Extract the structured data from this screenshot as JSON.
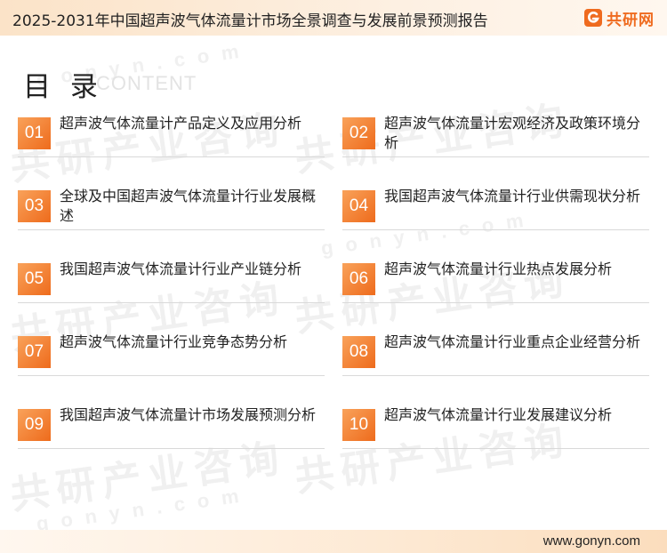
{
  "header": {
    "title": "2025-2031年中国超声波气体流量计市场全景调查与发展前景预测报告",
    "brand": "共研网",
    "logo_icon": "g-logo-icon"
  },
  "toc": {
    "heading": "目 录",
    "subheading": "CONTENT"
  },
  "watermark": {
    "cn": "共研产业咨询",
    "en": "gonyn.com"
  },
  "items": [
    {
      "num": "01",
      "label": "超声波气体流量计产品定义及应用分析"
    },
    {
      "num": "02",
      "label": "超声波气体流量计宏观经济及政策环境分析"
    },
    {
      "num": "03",
      "label": "全球及中国超声波气体流量计行业发展概述"
    },
    {
      "num": "04",
      "label": "我国超声波气体流量计行业供需现状分析"
    },
    {
      "num": "05",
      "label": "我国超声波气体流量计行业产业链分析"
    },
    {
      "num": "06",
      "label": "超声波气体流量计行业热点发展分析"
    },
    {
      "num": "07",
      "label": "超声波气体流量计行业竞争态势分析"
    },
    {
      "num": "08",
      "label": "超声波气体流量计行业重点企业经营分析"
    },
    {
      "num": "09",
      "label": "我国超声波气体流量计市场发展预测分析"
    },
    {
      "num": "10",
      "label": "超声波气体流量计行业发展建议分析"
    }
  ],
  "footer": {
    "url": "www.gonyn.com"
  },
  "colors": {
    "accent": "#ee6b1c",
    "header_bg": "#fbe3c8"
  }
}
